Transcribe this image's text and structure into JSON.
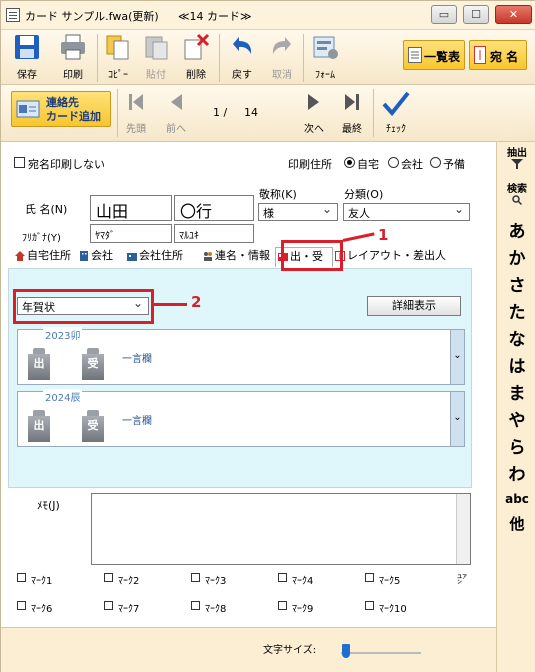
{
  "window": {
    "title": "カード サンプル.fwa(更新)",
    "card_count": "≪14 カード≫",
    "controls": {
      "minimize": "▭",
      "maximize": "☐",
      "close": "✕"
    }
  },
  "toolbar": {
    "save": "保存",
    "print": "印刷",
    "copy": "ｺﾋﾟｰ",
    "paste": "貼付",
    "delete": "削除",
    "undo": "戻す",
    "redo": "取消",
    "form": "ﾌｫｰﾑ",
    "list": "一覧表",
    "address": "宛 名"
  },
  "navbar": {
    "add_card_line1": "連絡先",
    "add_card_line2": "カード追加",
    "first": "先頭",
    "prev": "前へ",
    "next": "次へ",
    "last": "最終",
    "check": "ﾁｪｯｸ",
    "current_page": "1 /",
    "total_pages": "14"
  },
  "index": {
    "extract": "抽出",
    "search": "検索",
    "kana": [
      "あ",
      "か",
      "さ",
      "た",
      "な",
      "は",
      "ま",
      "や",
      "ら",
      "わ"
    ],
    "abc": "abc",
    "other": "他"
  },
  "form": {
    "no_print_label": "宛名印刷しない",
    "print_address_label": "印刷住所",
    "address_options": [
      "自宅",
      "会社",
      "予備"
    ],
    "name_label": "氏 名(N)",
    "kana_label": "ﾌﾘｶﾞﾅ(Y)",
    "last_name": "山田",
    "first_name": "〇行",
    "last_name_kana": "ﾔﾏﾀﾞ",
    "first_name_kana": "ﾏﾙﾕｷ",
    "honorific_label": "敬称(K)",
    "honorific_value": "様",
    "category_label": "分類(O)",
    "category_value": "友人"
  },
  "tabs": [
    "自宅住所",
    "会社",
    "会社住所",
    "連名・情報",
    "出・受",
    "レイアウト・差出人"
  ],
  "panel": {
    "card_type": "年賀状",
    "detail_button": "詳細表示",
    "years": [
      {
        "label": "2023卯",
        "sent": "出",
        "received": "受",
        "note": "一言欄"
      },
      {
        "label": "2024辰",
        "sent": "出",
        "received": "受",
        "note": "一言欄"
      }
    ],
    "scroll_glyph": "⌄"
  },
  "annotations": {
    "marker1": "1",
    "marker2": "2"
  },
  "memo_label": "ﾒﾓ(J)",
  "marks_row1": [
    "ﾏｰｸ1",
    "ﾏｰｸ2",
    "ﾏｰｸ3",
    "ﾏｰｸ4",
    "ﾏｰｸ5"
  ],
  "marks_row2": [
    "ﾏｰｸ6",
    "ﾏｰｸ7",
    "ﾏｰｸ8",
    "ﾏｰｸ9",
    "ﾏｰｸ10"
  ],
  "marks_side": "㍐",
  "bottom": {
    "font_size_label": "文字サイズ:"
  },
  "colors": {
    "accent": "#f8c52e",
    "panel": "#dff7fb",
    "marker": "#d9202a",
    "link": "#1f4e8c"
  }
}
